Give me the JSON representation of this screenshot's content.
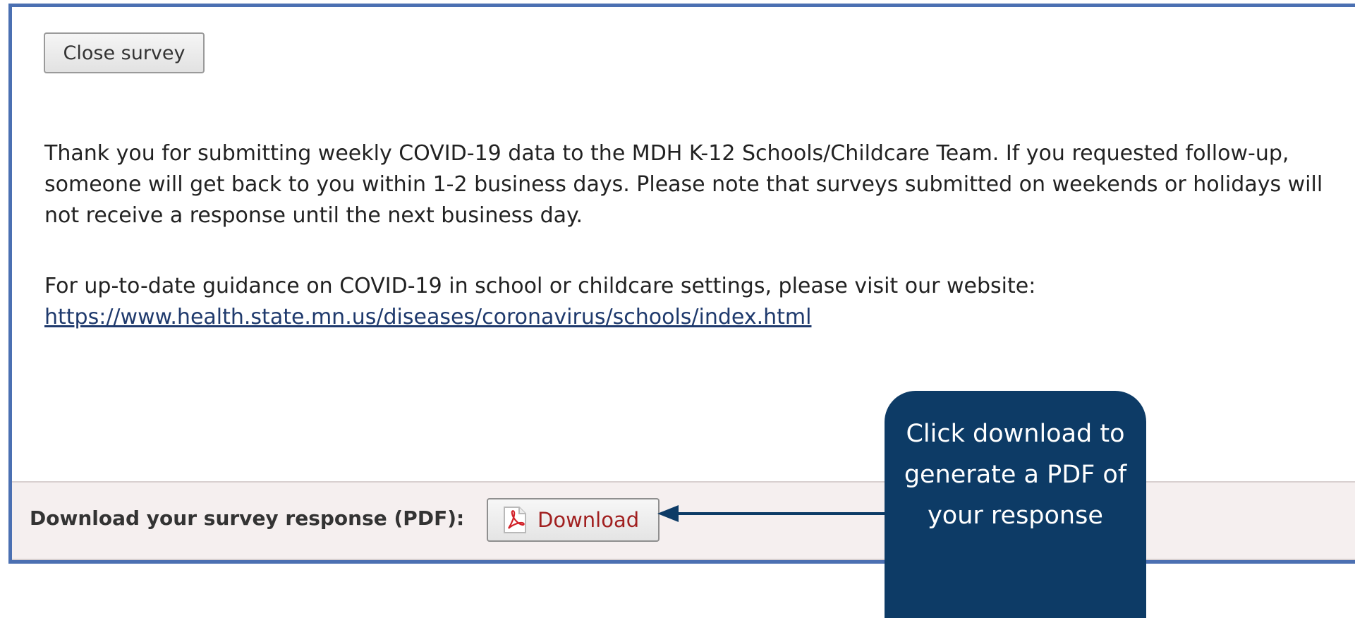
{
  "survey": {
    "close_label": "Close survey",
    "thank_you": "Thank you for submitting weekly COVID-19 data to the MDH K-12 Schools/Childcare Team. If you requested follow-up, someone will get back to you within 1-2 business days. Please note that surveys submitted on weekends or holidays will not receive a response until the next business day.",
    "guidance_text": "For up-to-date guidance on COVID-19 in school or childcare settings, please visit our website:",
    "guidance_link": "https://www.health.state.mn.us/diseases/coronavirus/schools/index.html"
  },
  "download_bar": {
    "label": "Download your survey response (PDF):",
    "button_label": "Download",
    "button_icon": "pdf-icon"
  },
  "callout": {
    "text": "Click download to generate a PDF of your response"
  },
  "colors": {
    "frame_border": "#4b70b2",
    "callout_bg": "#0d3b66",
    "download_text": "#a12020",
    "link": "#1f3a6d"
  }
}
